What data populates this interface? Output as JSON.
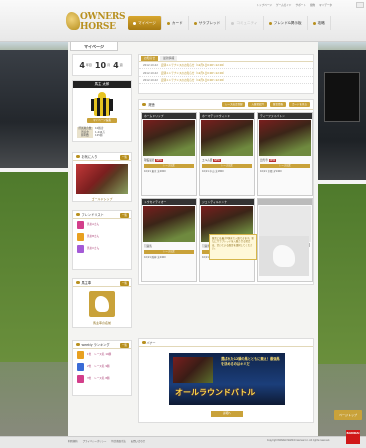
{
  "header": {
    "top_links": [
      "トップページ",
      "ゲームガイド",
      "サポート",
      "規約",
      "マイデータ"
    ],
    "logo_line1": "OWNERS",
    "logo_line2": "HORSE",
    "nav": [
      {
        "label": "マイページ",
        "active": true
      },
      {
        "label": "カード",
        "active": false
      },
      {
        "label": "サラブレッド",
        "active": false
      },
      {
        "label": "コミュニティ",
        "active": false
      },
      {
        "label": "フレンド&掲示板",
        "active": false
      },
      {
        "label": "攻略",
        "active": false
      }
    ]
  },
  "page": {
    "subtab": "マイページ",
    "date": {
      "year": "4",
      "year_unit": "年目",
      "month": "10",
      "month_unit": "月",
      "week": "4",
      "week_unit": "週"
    },
    "owner": {
      "name": "馬主 太郎",
      "button": "マイページ編集",
      "info": [
        {
          "k": "所属厩舎数",
          "v": "10厩舎"
        },
        {
          "k": "所持金",
          "v": "1,444万"
        },
        {
          "k": "勝利数",
          "v": "125勝"
        }
      ]
    },
    "favorite": {
      "title": "お気に入り",
      "btn": "一覧",
      "horse_name": "ゴールドシップ"
    },
    "friends": {
      "title": "フレンドリスト",
      "btn": "一覧",
      "items": [
        {
          "name": "馬主Aさん",
          "silk": "#d33e8a"
        },
        {
          "name": "馬主Bさん",
          "silk": "#e8a020"
        },
        {
          "name": "馬主Cさん",
          "silk": "#a45ad6"
        }
      ]
    },
    "stable_owner": {
      "title": "馬主車",
      "btn": "一覧",
      "caption": "馬主車の名前"
    },
    "ranking": {
      "title": "weekly ランキング",
      "btn": "一覧",
      "items": [
        {
          "rank": "1位",
          "text": "レース名 10勝",
          "silk": "#e8a020"
        },
        {
          "rank": "2位",
          "text": "レース名 9勝",
          "silk": "#3a6bd6"
        },
        {
          "rank": "3位",
          "text": "レース名 8勝",
          "silk": "#d33e8a"
        }
      ]
    }
  },
  "notice": {
    "tabs": [
      "お知らせ",
      "最新情報"
    ],
    "lines": [
      {
        "date": "2012.10.22",
        "text": "定期メンテナンスのお知らせ（12月1日0:00〜12:00）"
      },
      {
        "date": "2012.10.22",
        "text": "定期メンテナンスのお知らせ（12月1日0:00〜12:00）"
      },
      {
        "date": "2012.10.22",
        "text": "定期メンテナンスのお知らせ（12月1日0:00〜12:00）"
      }
    ]
  },
  "stable": {
    "title": "厩舎",
    "buttons": [
      "レース出走登録",
      "入厩者紹介",
      "厩舎情報",
      "カードを見る"
    ],
    "cards": [
      {
        "name": "ホームドリップ",
        "status": "現役競走",
        "new": "NEW",
        "bar": "レース出走",
        "detail": "10/21 東京 芝2000",
        "pic": true
      },
      {
        "name": "ホーマテッドウィンド",
        "status": "エルム賞",
        "new": "NEW",
        "bar": "レース出走",
        "detail": "10/21 中山 芝1800",
        "pic": true
      },
      {
        "name": "ティーファイバトン",
        "status": "田光寺",
        "new": "NEW",
        "bar": "レース出走",
        "detail": "10/21 京都 ダ1400",
        "pic": true
      },
      {
        "name": "トウカイテイオー",
        "status": "引退馬",
        "new": "",
        "bar": "レース出走",
        "detail": "10/21 阪神 芝2400",
        "pic": true
      },
      {
        "name": "ジェンティルドンナ",
        "status": "引退馬",
        "new": "",
        "bar": "レース出走",
        "detail": "10/21 東京 芝2400",
        "pic": true
      },
      {
        "name": "",
        "status": "",
        "new": "",
        "bar": "入厩",
        "detail": "",
        "pic": false
      }
    ],
    "tooltip": "厩舎には最大6頭まで入厩できます。新たにサラブレッドを入厩させる場合は、空いている厩舎を選択してください。"
  },
  "banner_box": {
    "title": "バナー",
    "banner_sub": "選ばれた12頭の馬とともに競え！最強馬を決めるのはキミだ",
    "banner_title": "オールラウンドバトル",
    "btn": "詳細へ"
  },
  "footer": {
    "links": [
      "利用規約",
      "プライバシーポリシー",
      "特定商取引法",
      "お問い合わせ"
    ],
    "copyright": "Copyright BANDAI NAMCO Games Inc. All rights reserved.",
    "page_top": "ページトップ",
    "bandai": "BANDAI"
  },
  "colors": {
    "gold": "#c9a23a",
    "dark": "#2c2c2c",
    "accent_red": "#b83030"
  }
}
